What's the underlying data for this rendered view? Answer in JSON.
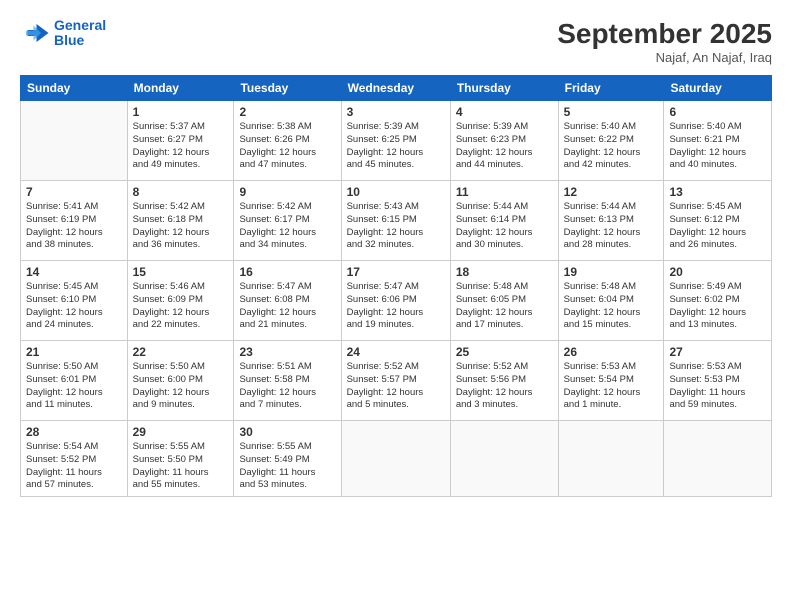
{
  "header": {
    "logo_line1": "General",
    "logo_line2": "Blue",
    "month": "September 2025",
    "location": "Najaf, An Najaf, Iraq"
  },
  "weekdays": [
    "Sunday",
    "Monday",
    "Tuesday",
    "Wednesday",
    "Thursday",
    "Friday",
    "Saturday"
  ],
  "weeks": [
    [
      {
        "day": "",
        "content": ""
      },
      {
        "day": "1",
        "content": "Sunrise: 5:37 AM\nSunset: 6:27 PM\nDaylight: 12 hours\nand 49 minutes."
      },
      {
        "day": "2",
        "content": "Sunrise: 5:38 AM\nSunset: 6:26 PM\nDaylight: 12 hours\nand 47 minutes."
      },
      {
        "day": "3",
        "content": "Sunrise: 5:39 AM\nSunset: 6:25 PM\nDaylight: 12 hours\nand 45 minutes."
      },
      {
        "day": "4",
        "content": "Sunrise: 5:39 AM\nSunset: 6:23 PM\nDaylight: 12 hours\nand 44 minutes."
      },
      {
        "day": "5",
        "content": "Sunrise: 5:40 AM\nSunset: 6:22 PM\nDaylight: 12 hours\nand 42 minutes."
      },
      {
        "day": "6",
        "content": "Sunrise: 5:40 AM\nSunset: 6:21 PM\nDaylight: 12 hours\nand 40 minutes."
      }
    ],
    [
      {
        "day": "7",
        "content": "Sunrise: 5:41 AM\nSunset: 6:19 PM\nDaylight: 12 hours\nand 38 minutes."
      },
      {
        "day": "8",
        "content": "Sunrise: 5:42 AM\nSunset: 6:18 PM\nDaylight: 12 hours\nand 36 minutes."
      },
      {
        "day": "9",
        "content": "Sunrise: 5:42 AM\nSunset: 6:17 PM\nDaylight: 12 hours\nand 34 minutes."
      },
      {
        "day": "10",
        "content": "Sunrise: 5:43 AM\nSunset: 6:15 PM\nDaylight: 12 hours\nand 32 minutes."
      },
      {
        "day": "11",
        "content": "Sunrise: 5:44 AM\nSunset: 6:14 PM\nDaylight: 12 hours\nand 30 minutes."
      },
      {
        "day": "12",
        "content": "Sunrise: 5:44 AM\nSunset: 6:13 PM\nDaylight: 12 hours\nand 28 minutes."
      },
      {
        "day": "13",
        "content": "Sunrise: 5:45 AM\nSunset: 6:12 PM\nDaylight: 12 hours\nand 26 minutes."
      }
    ],
    [
      {
        "day": "14",
        "content": "Sunrise: 5:45 AM\nSunset: 6:10 PM\nDaylight: 12 hours\nand 24 minutes."
      },
      {
        "day": "15",
        "content": "Sunrise: 5:46 AM\nSunset: 6:09 PM\nDaylight: 12 hours\nand 22 minutes."
      },
      {
        "day": "16",
        "content": "Sunrise: 5:47 AM\nSunset: 6:08 PM\nDaylight: 12 hours\nand 21 minutes."
      },
      {
        "day": "17",
        "content": "Sunrise: 5:47 AM\nSunset: 6:06 PM\nDaylight: 12 hours\nand 19 minutes."
      },
      {
        "day": "18",
        "content": "Sunrise: 5:48 AM\nSunset: 6:05 PM\nDaylight: 12 hours\nand 17 minutes."
      },
      {
        "day": "19",
        "content": "Sunrise: 5:48 AM\nSunset: 6:04 PM\nDaylight: 12 hours\nand 15 minutes."
      },
      {
        "day": "20",
        "content": "Sunrise: 5:49 AM\nSunset: 6:02 PM\nDaylight: 12 hours\nand 13 minutes."
      }
    ],
    [
      {
        "day": "21",
        "content": "Sunrise: 5:50 AM\nSunset: 6:01 PM\nDaylight: 12 hours\nand 11 minutes."
      },
      {
        "day": "22",
        "content": "Sunrise: 5:50 AM\nSunset: 6:00 PM\nDaylight: 12 hours\nand 9 minutes."
      },
      {
        "day": "23",
        "content": "Sunrise: 5:51 AM\nSunset: 5:58 PM\nDaylight: 12 hours\nand 7 minutes."
      },
      {
        "day": "24",
        "content": "Sunrise: 5:52 AM\nSunset: 5:57 PM\nDaylight: 12 hours\nand 5 minutes."
      },
      {
        "day": "25",
        "content": "Sunrise: 5:52 AM\nSunset: 5:56 PM\nDaylight: 12 hours\nand 3 minutes."
      },
      {
        "day": "26",
        "content": "Sunrise: 5:53 AM\nSunset: 5:54 PM\nDaylight: 12 hours\nand 1 minute."
      },
      {
        "day": "27",
        "content": "Sunrise: 5:53 AM\nSunset: 5:53 PM\nDaylight: 11 hours\nand 59 minutes."
      }
    ],
    [
      {
        "day": "28",
        "content": "Sunrise: 5:54 AM\nSunset: 5:52 PM\nDaylight: 11 hours\nand 57 minutes."
      },
      {
        "day": "29",
        "content": "Sunrise: 5:55 AM\nSunset: 5:50 PM\nDaylight: 11 hours\nand 55 minutes."
      },
      {
        "day": "30",
        "content": "Sunrise: 5:55 AM\nSunset: 5:49 PM\nDaylight: 11 hours\nand 53 minutes."
      },
      {
        "day": "",
        "content": ""
      },
      {
        "day": "",
        "content": ""
      },
      {
        "day": "",
        "content": ""
      },
      {
        "day": "",
        "content": ""
      }
    ]
  ]
}
